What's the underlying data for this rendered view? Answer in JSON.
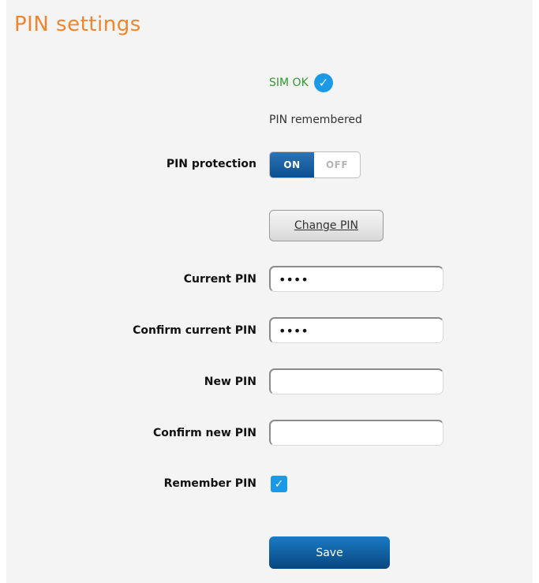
{
  "page": {
    "title": "PIN settings"
  },
  "sim_status": {
    "text": "SIM OK",
    "icon": "check-circle-icon",
    "color": "#2f9a2f"
  },
  "pin_status": "PIN remembered",
  "pin_protection": {
    "label": "PIN protection",
    "on_label": "ON",
    "off_label": "OFF",
    "value": "ON"
  },
  "change_pin_button": "Change PIN",
  "fields": {
    "current_pin": {
      "label": "Current PIN",
      "value": "••••"
    },
    "confirm_current_pin": {
      "label": "Confirm current PIN",
      "value": "••••"
    },
    "new_pin": {
      "label": "New PIN",
      "value": ""
    },
    "confirm_new_pin": {
      "label": "Confirm new PIN",
      "value": ""
    }
  },
  "remember_pin": {
    "label": "Remember PIN",
    "checked": true
  },
  "save_button": "Save",
  "colors": {
    "title": "#f0852d",
    "accent_blue": "#1a9ae6",
    "button_blue": "#0d4f8f"
  }
}
